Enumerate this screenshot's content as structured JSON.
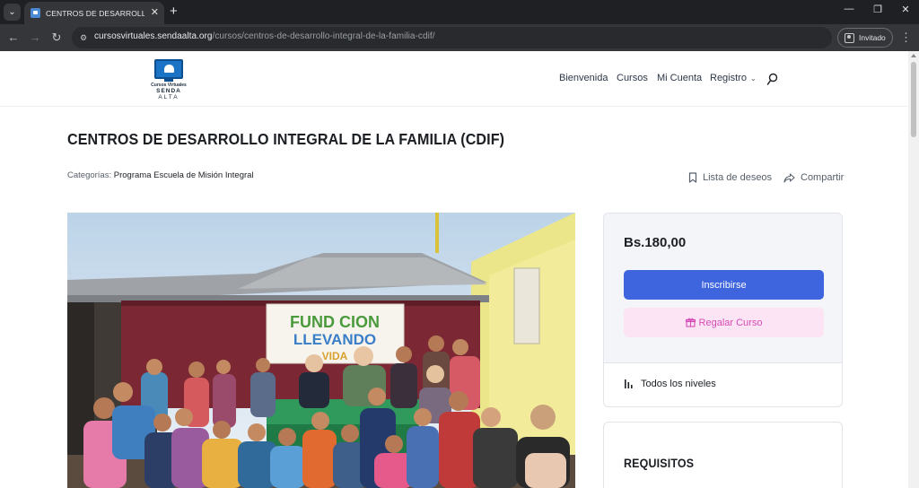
{
  "browser": {
    "tab_title": "CENTROS DE DESARROLLO INTE",
    "url_host": "cursosvirtuales.sendaalta.org",
    "url_path": "/cursos/centros-de-desarrollo-integral-de-la-familia-cdif/",
    "profile_label": "Invitado"
  },
  "header": {
    "logo_line1": "Cursos Virtuales",
    "logo_line2": "SENDA",
    "logo_line3": "ALTA",
    "nav": {
      "bienvenida": "Bienvenida",
      "cursos": "Cursos",
      "mi_cuenta": "Mi Cuenta",
      "registro": "Registro"
    }
  },
  "course": {
    "title": "CENTROS DE DESARROLLO INTEGRAL DE LA FAMILIA (CDIF)",
    "categories_label": "Categorías:",
    "category": "Programa Escuela de Misión Integral",
    "wishlist_label": "Lista de deseos",
    "share_label": "Compartir"
  },
  "photo": {
    "banner_line1": "FUND CION",
    "banner_line2": "LLEVANDO",
    "banner_line3": "VIDA"
  },
  "sidebar": {
    "price": "Bs.180,00",
    "enroll_label": "Inscribirse",
    "gift_label": "Regalar Curso",
    "level_label": "Todos los niveles",
    "requirements_title": "REQUISITOS"
  },
  "colors": {
    "enroll_button": "#3e64de",
    "gift_button_bg": "#fce4f4",
    "gift_button_text": "#d64bb7",
    "browser_frame": "#1f2023"
  }
}
